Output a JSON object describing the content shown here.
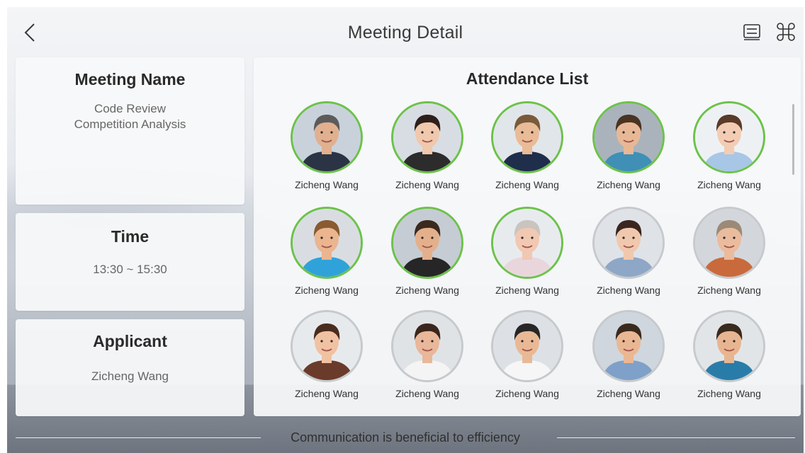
{
  "header": {
    "title": "Meeting Detail",
    "back_icon": "chevron-left-icon",
    "list_icon": "list-icon",
    "grid_icon": "command-icon"
  },
  "meeting_card": {
    "title": "Meeting Name",
    "lines": [
      "Code Review",
      "Competition  Analysis"
    ]
  },
  "time_card": {
    "title": "Time",
    "value": "13:30 ~ 15:30"
  },
  "applicant_card": {
    "title": "Applicant",
    "value": "Zicheng Wang"
  },
  "attendance": {
    "title": "Attendance List",
    "people": [
      {
        "name": "Zicheng Wang",
        "confirmed": true,
        "skin": "#e0b08f",
        "hair": "#5b5b5b",
        "shirt": "#2b3444",
        "bg": "#c9d2db"
      },
      {
        "name": "Zicheng Wang",
        "confirmed": true,
        "skin": "#f0c8ad",
        "hair": "#2e1f1a",
        "shirt": "#2c2c2c",
        "bg": "#d8dde3"
      },
      {
        "name": "Zicheng Wang",
        "confirmed": true,
        "skin": "#e9bb97",
        "hair": "#7a5a3a",
        "shirt": "#1f2e4a",
        "bg": "#e1e6ea"
      },
      {
        "name": "Zicheng Wang",
        "confirmed": true,
        "skin": "#e8b896",
        "hair": "#4a3322",
        "shirt": "#3f8fb6",
        "bg": "#aab3bc"
      },
      {
        "name": "Zicheng Wang",
        "confirmed": true,
        "skin": "#f2cdb4",
        "hair": "#5a3a28",
        "shirt": "#a8c6e6",
        "bg": "#eef1f4"
      },
      {
        "name": "Zicheng Wang",
        "confirmed": true,
        "skin": "#eab58f",
        "hair": "#8a5a30",
        "shirt": "#2fa3d9",
        "bg": "#d9dde2"
      },
      {
        "name": "Zicheng Wang",
        "confirmed": true,
        "skin": "#e4b08c",
        "hair": "#3a2a1e",
        "shirt": "#262626",
        "bg": "#c6ccd3"
      },
      {
        "name": "Zicheng Wang",
        "confirmed": true,
        "skin": "#f1c8b1",
        "hair": "#c9c4bf",
        "shirt": "#e9d6dd",
        "bg": "#e8ebee"
      },
      {
        "name": "Zicheng Wang",
        "confirmed": false,
        "skin": "#f0c8ad",
        "hair": "#3a2620",
        "shirt": "#8ea7c6",
        "bg": "#dfe3e8"
      },
      {
        "name": "Zicheng Wang",
        "confirmed": false,
        "skin": "#ebbb9d",
        "hair": "#9a8a76",
        "shirt": "#c96a3c",
        "bg": "#d3d7dc"
      },
      {
        "name": "Zicheng Wang",
        "confirmed": false,
        "skin": "#f0c2a2",
        "hair": "#4a2c1e",
        "shirt": "#6a3b2a",
        "bg": "#e7eaed"
      },
      {
        "name": "Zicheng Wang",
        "confirmed": false,
        "skin": "#e9b79a",
        "hair": "#3a261c",
        "shirt": "#f4f4f4",
        "bg": "#e0e3e6"
      },
      {
        "name": "Zicheng Wang",
        "confirmed": false,
        "skin": "#e9b996",
        "hair": "#262626",
        "shirt": "#f6f6f6",
        "bg": "#dde1e5"
      },
      {
        "name": "Zicheng Wang",
        "confirmed": false,
        "skin": "#eab793",
        "hair": "#3a2a1e",
        "shirt": "#7fa0c8",
        "bg": "#cfd6dd"
      },
      {
        "name": "Zicheng Wang",
        "confirmed": false,
        "skin": "#e8b591",
        "hair": "#3a2a1e",
        "shirt": "#2a7ca8",
        "bg": "#e2e5e8"
      }
    ]
  },
  "footer": {
    "text": "Communication is beneficial to efficiency"
  }
}
